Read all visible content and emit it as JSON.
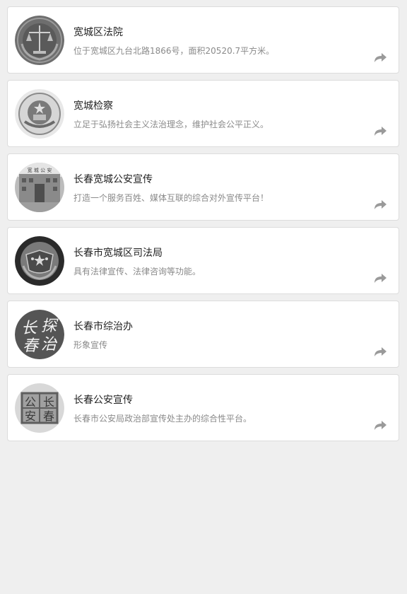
{
  "items": [
    {
      "title": "宽城区法院",
      "desc": "位于宽城区九台北路1866号，面积20520.7平方米。",
      "avatar_icon": "court-emblem-icon"
    },
    {
      "title": "宽城检察",
      "desc": "立足于弘扬社会主义法治理念，维护社会公平正义。",
      "avatar_icon": "procuratorate-emblem-icon"
    },
    {
      "title": "长春宽城公安宣传",
      "desc": "打造一个服务百姓、媒体互联的综合对外宣传平台！",
      "avatar_icon": "police-building-photo-icon",
      "sign_text": "宽 城 公 安"
    },
    {
      "title": "长春市宽城区司法局",
      "desc": "具有法律宣传、法律咨询等功能。",
      "avatar_icon": "justice-emblem-icon"
    },
    {
      "title": "长春市综治办",
      "desc": "形象宣传",
      "avatar_icon": "calligraphy-logo-icon",
      "logo_chars": [
        "长",
        "探",
        "春",
        "治"
      ]
    },
    {
      "title": "长春公安宣传",
      "desc": "长春市公安局政治部宣传处主办的综合性平台。",
      "avatar_icon": "police-seal-logo-icon",
      "seal_chars": [
        "公",
        "长",
        "安",
        "春"
      ]
    }
  ],
  "share_icon": "share-arrow-icon",
  "colors": {
    "background": "#efefef",
    "card": "#ffffff",
    "title": "#222222",
    "desc": "#8a8a8a",
    "icon": "#9a9a9a"
  }
}
